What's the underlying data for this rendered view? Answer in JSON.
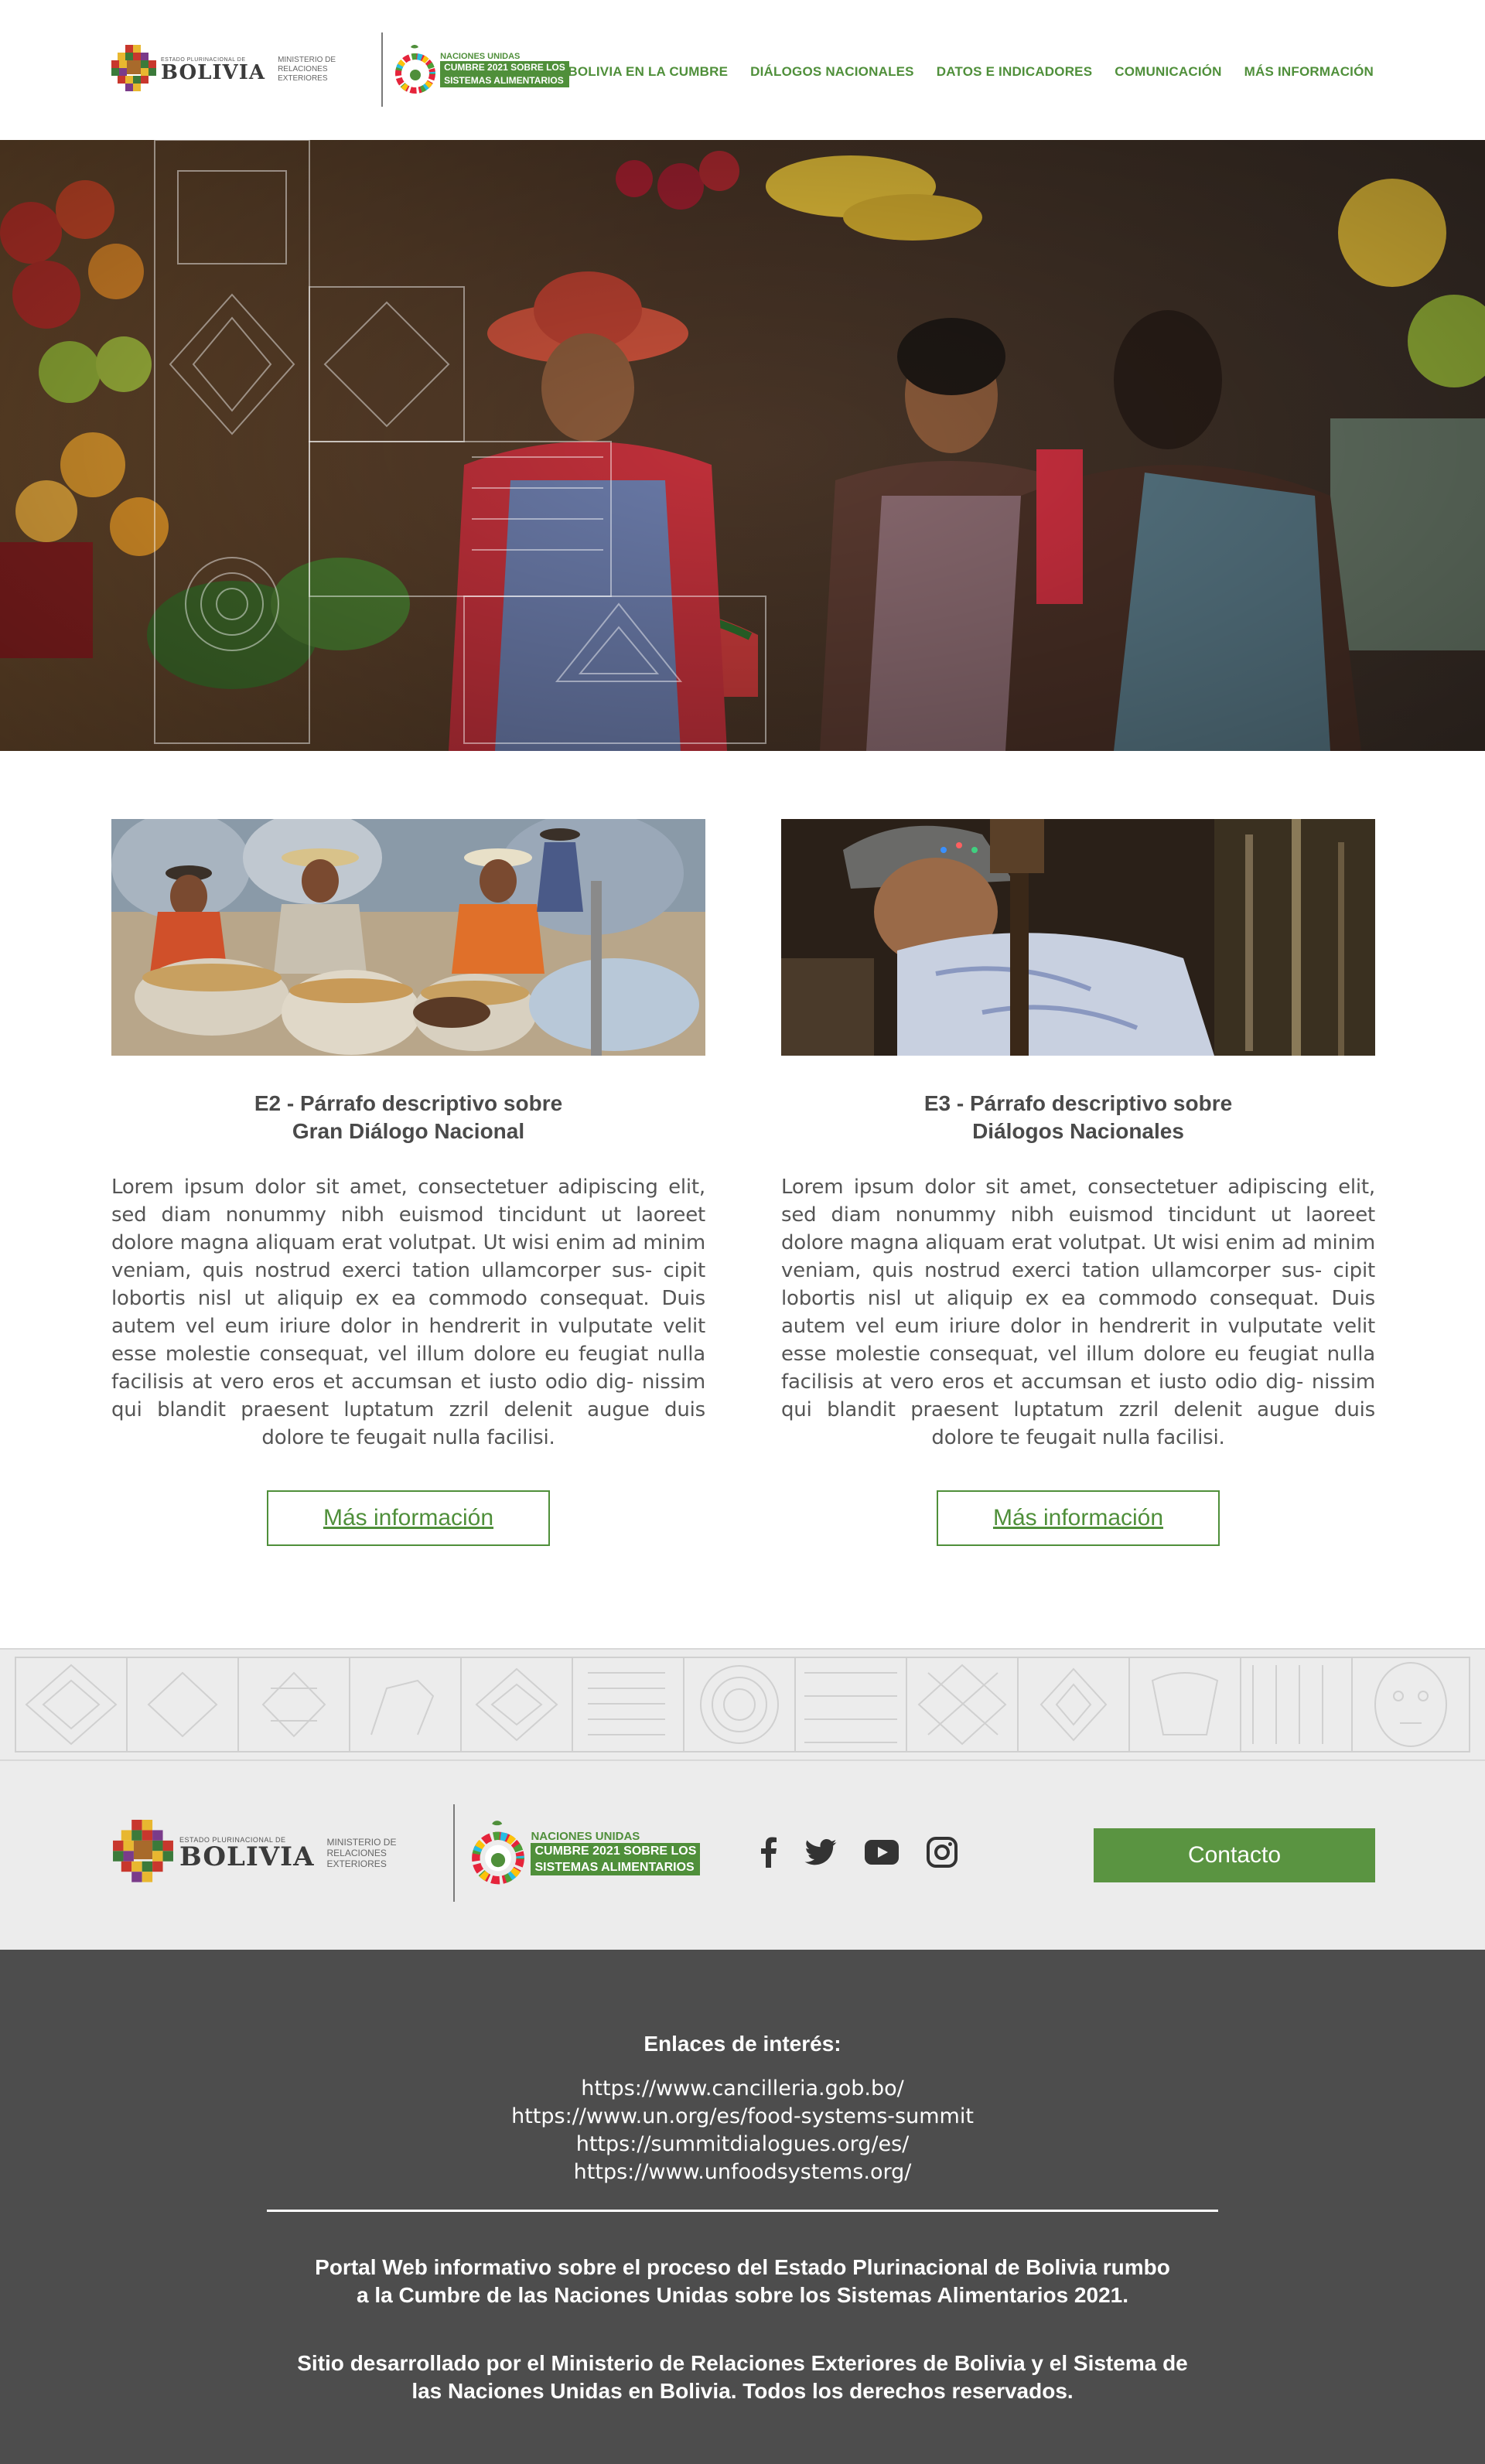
{
  "header": {
    "bolivia_logo": {
      "small_text": "ESTADO PLURINACIONAL DE",
      "name": "BOLIVIA",
      "ministry": "MINISTERIO DE RELACIONES EXTERIORES"
    },
    "un_logo": {
      "top_text": "NACIONES UNIDAS",
      "line1": "CUMBRE 2021 SOBRE LOS",
      "line2": "SISTEMAS ALIMENTARIOS"
    },
    "nav": [
      {
        "label": "BOLIVIA EN LA CUMBRE"
      },
      {
        "label": "DIÁLOGOS NACIONALES"
      },
      {
        "label": "DATOS E INDICADORES"
      },
      {
        "label": "COMUNICACIÓN"
      },
      {
        "label": "MÁS INFORMACIÓN"
      }
    ]
  },
  "cards": [
    {
      "title_line1": "E2 - Párrafo descriptivo sobre",
      "title_line2": "Gran Diálogo Nacional",
      "body": "Lorem ipsum dolor sit amet, consectetuer adipiscing elit, sed diam nonummy nibh euismod tincidunt ut laoreet dolore magna aliquam erat volutpat. Ut wisi enim ad minim veniam, quis nostrud exerci tation ullamcorper sus- cipit lobortis nisl ut aliquip ex ea commodo consequat. Duis autem vel eum iriure dolor in hendrerit in vulputate velit esse molestie consequat, vel illum dolore eu feugiat nulla facilisis at vero eros et accumsan et iusto odio dig- nissim qui blandit praesent luptatum zzril delenit augue duis dolore te feugait nulla facilisi.",
      "button": "Más información"
    },
    {
      "title_line1": "E3 - Párrafo descriptivo sobre",
      "title_line2": "Diálogos Nacionales",
      "body": "Lorem ipsum dolor sit amet, consectetuer adipiscing elit, sed diam nonummy nibh euismod tincidunt ut laoreet dolore magna aliquam erat volutpat. Ut wisi enim ad minim veniam, quis nostrud exerci tation ullamcorper sus- cipit lobortis nisl ut aliquip ex ea commodo consequat. Duis autem vel eum iriure dolor in hendrerit in vulputate velit esse molestie consequat, vel illum dolore eu feugiat nulla facilisis at vero eros et accumsan et iusto odio dig- nissim qui blandit praesent luptatum zzril delenit augue duis dolore te feugait nulla facilisi.",
      "button": "Más información"
    }
  ],
  "footer": {
    "social": [
      {
        "icon": "facebook-icon"
      },
      {
        "icon": "twitter-icon"
      },
      {
        "icon": "youtube-icon"
      },
      {
        "icon": "instagram-icon"
      }
    ],
    "contact_button": "Contacto",
    "links_title": "Enlaces de interés:",
    "links": [
      "https://www.cancilleria.gob.bo/",
      "https://www.un.org/es/food-systems-summit",
      "https://summitdialogues.org/es/",
      "https://www.unfoodsystems.org/"
    ],
    "description1_line1": "Portal Web informativo sobre el proceso del Estado Plurinacional de Bolivia rumbo",
    "description1_line2": "a la Cumbre de las Naciones Unidas sobre los Sistemas Alimentarios 2021.",
    "description2_line1": "Sitio desarrollado por el Ministerio de Relaciones Exteriores de Bolivia y el Sistema de",
    "description2_line2": "las Naciones Unidas en Bolivia. Todos los derechos reservados."
  },
  "colors": {
    "accent_green": "#4f8f3a",
    "contact_green": "#5a9441",
    "footer_dark": "#4d4d4d",
    "footer_light": "#ececec"
  }
}
